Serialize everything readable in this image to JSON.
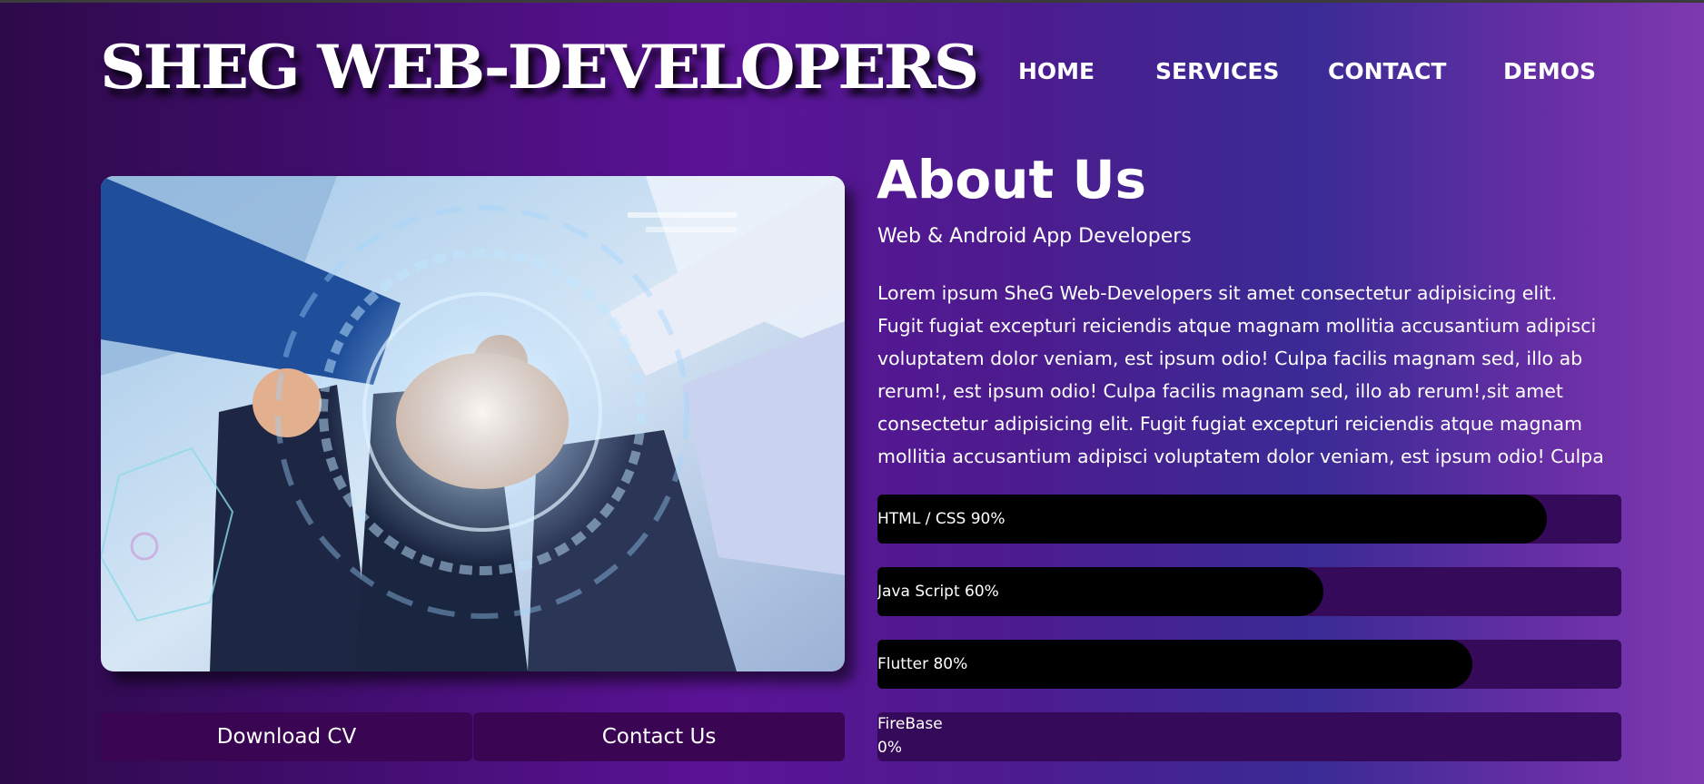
{
  "site": {
    "logo": "SHEG WEB-DEVELOPERS"
  },
  "nav": {
    "items": [
      "HOME",
      "SERVICES",
      "CONTACT",
      "DEMOS"
    ]
  },
  "hero_image": {
    "alt": "team fist bump",
    "icon": "team-photo"
  },
  "buttons": {
    "download_cv": "Download CV",
    "contact_us": "Contact Us"
  },
  "about": {
    "title": "About Us",
    "subtitle": "Web & Android App Developers",
    "lines": [
      "Lorem ipsum SheG Web-Developers sit amet consectetur adipisicing elit.",
      "Fugit fugiat excepturi reiciendis atque magnam mollitia accusantium adipisci",
      "voluptatem dolor veniam, est ipsum odio! Culpa facilis magnam sed, illo ab",
      "rerum!, est ipsum odio! Culpa facilis magnam sed, illo ab rerum!,sit amet",
      "consectetur adipisicing elit. Fugit fugiat excepturi reiciendis atque magnam",
      "mollitia accusantium adipisci voluptatem dolor veniam, est ipsum odio! Culpa"
    ]
  },
  "skills": [
    {
      "label": "HTML / CSS 90%",
      "level": 0.9
    },
    {
      "label": "Java Script 60%",
      "level": 0.6
    },
    {
      "label": "Flutter 80%",
      "level": 0.8
    },
    {
      "label": "FireBase 0%",
      "level": 0.0
    }
  ],
  "colors": {
    "button_bg": "#3a0553",
    "bar_track": "#360a5a",
    "bar_fill": "#000000",
    "text": "#ffffff"
  }
}
